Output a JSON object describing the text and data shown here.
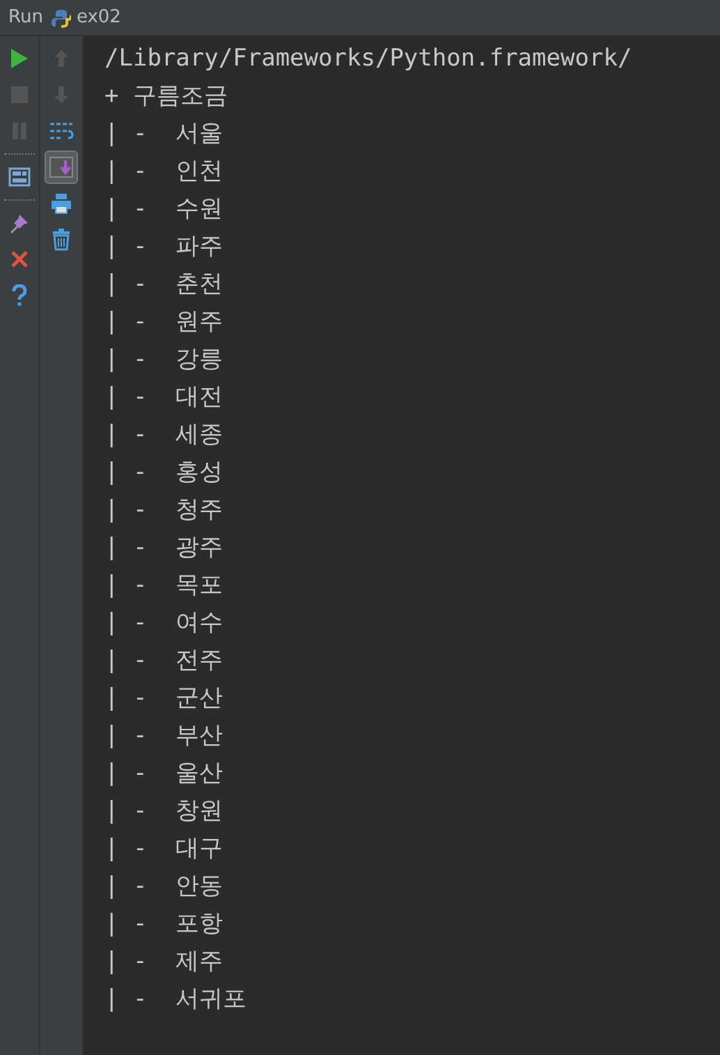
{
  "run_tab": {
    "label": "Run",
    "config": "ex02"
  },
  "left_toolbar": [
    {
      "kind": "run",
      "disabled": false
    },
    {
      "kind": "stop",
      "disabled": true
    },
    {
      "kind": "pause",
      "disabled": true
    },
    {
      "kind": "separator"
    },
    {
      "kind": "layout",
      "disabled": false
    },
    {
      "kind": "separator"
    },
    {
      "kind": "pin",
      "disabled": false
    },
    {
      "kind": "close",
      "disabled": false
    },
    {
      "kind": "help",
      "disabled": false
    }
  ],
  "right_toolbar": [
    {
      "kind": "up",
      "disabled": true,
      "selected": false
    },
    {
      "kind": "down",
      "disabled": true,
      "selected": false
    },
    {
      "kind": "wrap",
      "disabled": false,
      "selected": false
    },
    {
      "kind": "scroll",
      "disabled": false,
      "selected": true
    },
    {
      "kind": "print",
      "disabled": false,
      "selected": false
    },
    {
      "kind": "trash",
      "disabled": false,
      "selected": false
    }
  ],
  "console_lines": [
    "/Library/Frameworks/Python.framework/",
    "+ 구름조금",
    "| -  서울",
    "| -  인천",
    "| -  수원",
    "| -  파주",
    "| -  춘천",
    "| -  원주",
    "| -  강릉",
    "| -  대전",
    "| -  세종",
    "| -  홍성",
    "| -  청주",
    "| -  광주",
    "| -  목포",
    "| -  여수",
    "| -  전주",
    "| -  군산",
    "| -  부산",
    "| -  울산",
    "| -  창원",
    "| -  대구",
    "| -  안동",
    "| -  포항",
    "| -  제주",
    "| -  서귀포"
  ]
}
